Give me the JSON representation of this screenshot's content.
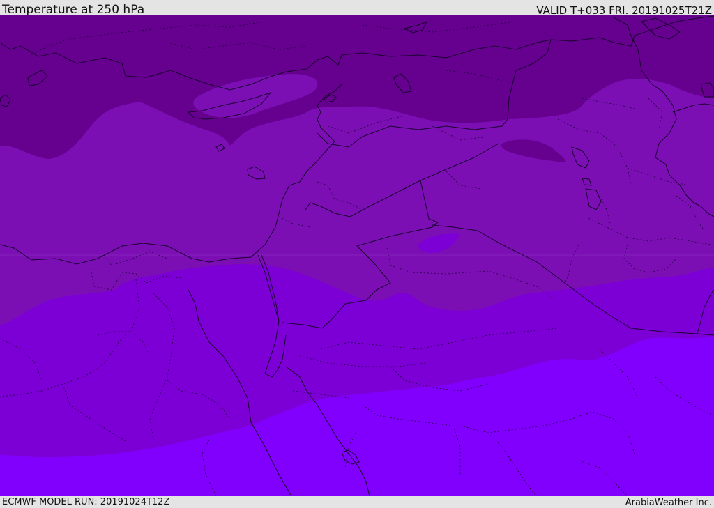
{
  "header": {
    "title": "Temperature at 250 hPa",
    "valid": "VALID T+033 FRI. 20191025T21Z"
  },
  "footer": {
    "model_run": "ECMWF MODEL RUN: 20191024T12Z",
    "credit": "ArabiaWeather Inc."
  },
  "colors": {
    "band_coldest": "#66008f",
    "band_cold": "#7b0fb4",
    "band_mid": "#7c00d6",
    "band_warm": "#8100fd",
    "border_line": "#1a0030"
  }
}
